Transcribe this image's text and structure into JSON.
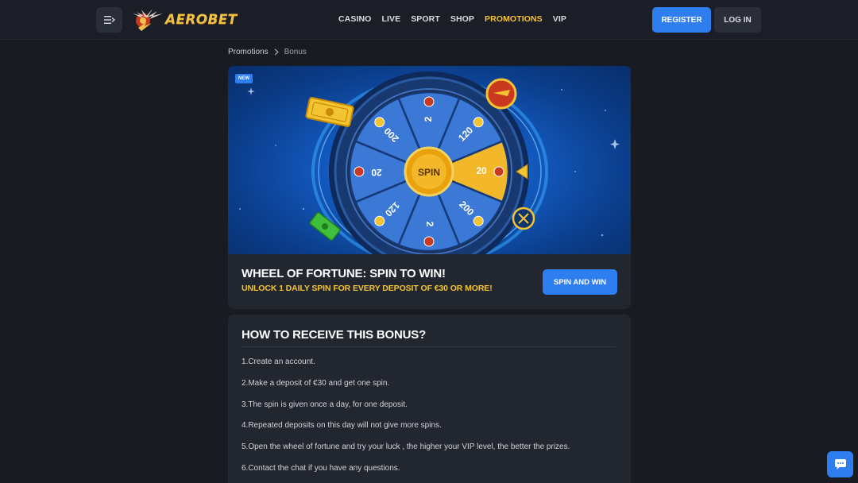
{
  "header": {
    "brand": "AEROBET",
    "nav": [
      "CASINO",
      "LIVE",
      "SPORT",
      "SHOP",
      "PROMOTIONS",
      "VIP"
    ],
    "active_nav": "PROMOTIONS",
    "register_label": "REGISTER",
    "login_label": "LOG IN"
  },
  "breadcrumb": [
    "Promotions",
    "Bonus"
  ],
  "promo": {
    "badge": "NEW",
    "wheel_center": "SPIN",
    "wheel_segments": [
      "20",
      "200",
      "2",
      "120",
      "20",
      "200",
      "2",
      "120"
    ],
    "title": "WHEEL OF FORTUNE: SPIN TO WIN!",
    "subtitle": "UNLOCK 1 DAILY SPIN FOR EVERY DEPOSIT OF €30 OR MORE!",
    "cta": "SPIN AND WIN"
  },
  "info": {
    "title": "HOW TO RECEIVE THIS BONUS?",
    "steps": [
      "1.Create an account.",
      "2.Make a deposit of €30 and get one spin.",
      "3.The spin is given once a day, for one deposit.",
      "4.Repeated deposits on this day will not give more spins.",
      "5.Open the wheel of fortune and try your luck , the higher your VIP level, the better the prizes.",
      "6.Contact the chat if you have any questions."
    ]
  },
  "colors": {
    "accent_blue": "#2f7ef0",
    "accent_yellow": "#f3c431",
    "background": "#181b22",
    "card": "#22262f"
  },
  "icons": {
    "menu": "menu-collapse-icon",
    "chat": "chat-support-icon",
    "breadcrumb_separator": "chevron-right-icon"
  }
}
